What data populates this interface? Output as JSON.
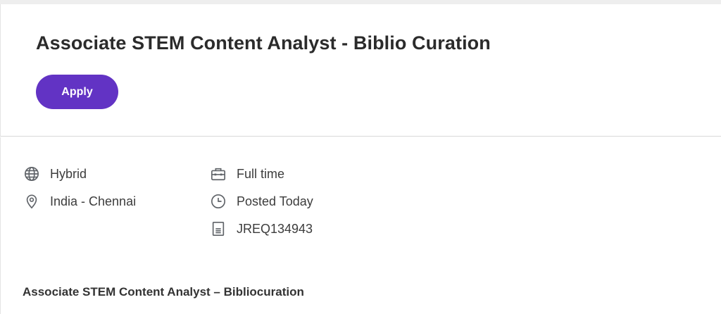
{
  "job": {
    "title": "Associate STEM Content Analyst - Biblio Curation",
    "apply_label": "Apply"
  },
  "meta": {
    "left": [
      {
        "icon": "globe-icon",
        "label": "Hybrid"
      },
      {
        "icon": "location-pin-icon",
        "label": "India - Chennai"
      }
    ],
    "right": [
      {
        "icon": "briefcase-icon",
        "label": "Full time"
      },
      {
        "icon": "clock-icon",
        "label": "Posted Today"
      },
      {
        "icon": "document-icon",
        "label": "JREQ134943"
      }
    ]
  },
  "description": {
    "heading": "Associate STEM Content Analyst – Bibliocuration"
  },
  "colors": {
    "accent": "#6233c4",
    "icon": "#5f6368"
  }
}
